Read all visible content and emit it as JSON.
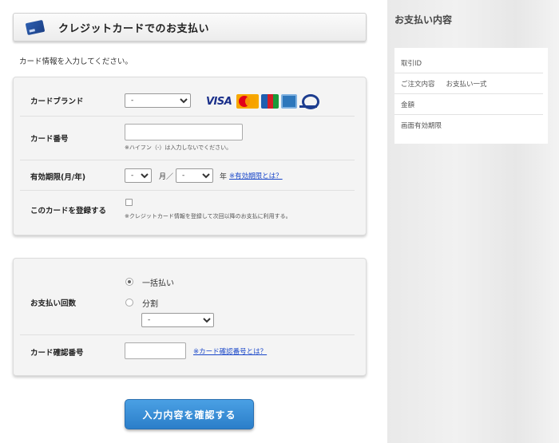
{
  "header": {
    "title": "クレジットカードでのお支払い",
    "icon": "credit-card-icon"
  },
  "intro": "カード情報を入力してください。",
  "card_brand": {
    "label": "カードブランド",
    "selected": "-",
    "logos": {
      "visa": "VISA",
      "mastercard": "MasterCard",
      "jcb": "JCB",
      "amex": "AMEX",
      "diners": "Diners Club"
    }
  },
  "card_number": {
    "label": "カード番号",
    "value": "",
    "note": "※ハイフン（-）は入力しないでください。"
  },
  "expiry": {
    "label": "有効期限(月/年)",
    "month_selected": "-",
    "month_unit": "月／",
    "year_selected": "-",
    "year_unit": "年",
    "help_link": "※有効期限とは？"
  },
  "register": {
    "label": "このカードを登録する",
    "checked": false,
    "note": "※クレジットカード情報を登録して次回以降のお支払に利用する。"
  },
  "payment_count": {
    "label": "お支払い回数",
    "options": [
      {
        "label": "一括払い",
        "selected": true
      },
      {
        "label": "分割",
        "selected": false
      }
    ],
    "installments_selected": "-"
  },
  "security_code": {
    "label": "カード確認番号",
    "value": "",
    "help_link": "※カード確認番号とは？"
  },
  "confirm_button": "入力内容を確認する",
  "sidebar": {
    "title": "お支払い内容",
    "rows": [
      {
        "label": "取引ID",
        "value": ""
      },
      {
        "label": "ご注文内容",
        "value": "お支払い一式"
      },
      {
        "label": "金額",
        "value": ""
      },
      {
        "label": "画面有効期限",
        "value": ""
      }
    ]
  },
  "colors": {
    "button": "#2b7ec9",
    "link": "#1a47c9",
    "panel_bg": "#f4f4f4"
  }
}
